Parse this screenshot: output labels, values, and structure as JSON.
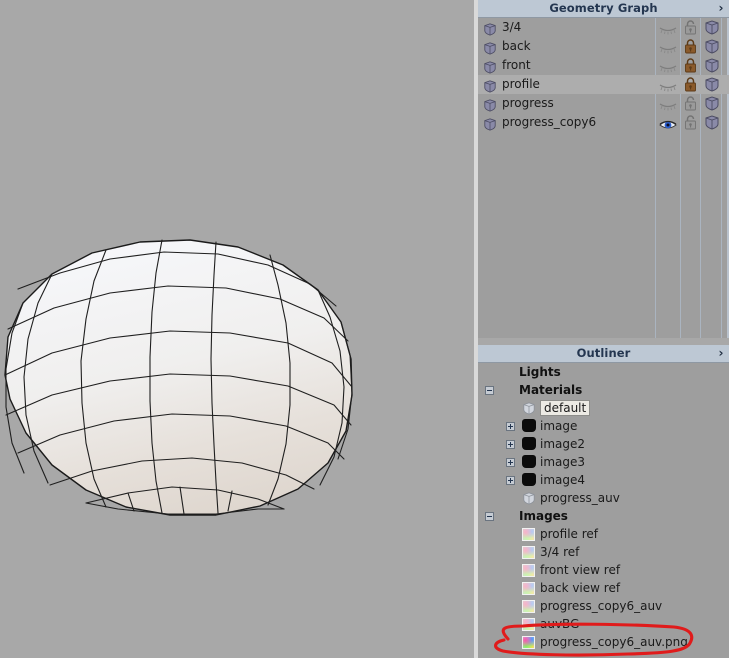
{
  "app": {
    "viewport": {
      "name": "3d-viewport",
      "background_color": "#a8a8a8",
      "model": "low-poly sphere wireframe",
      "mesh_color": "#f2f0ee",
      "wire_color": "#1a1a1a"
    }
  },
  "geometry_graph": {
    "title": "Geometry Graph",
    "chevron": "›",
    "columns": [
      "name",
      "visibility",
      "lock",
      "render"
    ],
    "rows": [
      {
        "label": "3/4",
        "visible": false,
        "locked": false,
        "selected": false
      },
      {
        "label": "back",
        "visible": false,
        "locked": true,
        "selected": false
      },
      {
        "label": "front",
        "visible": false,
        "locked": true,
        "selected": false
      },
      {
        "label": "profile",
        "visible": false,
        "locked": true,
        "selected": true
      },
      {
        "label": "progress",
        "visible": false,
        "locked": false,
        "selected": false
      },
      {
        "label": "progress_copy6",
        "visible": true,
        "locked": false,
        "selected": false
      }
    ]
  },
  "outliner": {
    "title": "Outliner",
    "chevron": "›",
    "groups": [
      {
        "label": "Lights",
        "expander": "none",
        "items": []
      },
      {
        "label": "Materials",
        "expander": "minus",
        "items": [
          {
            "label": "default",
            "icon": "cube-icon",
            "expander": "none",
            "highlight": true
          },
          {
            "label": "image",
            "icon": "black-material-icon",
            "expander": "plus",
            "highlight": false
          },
          {
            "label": "image2",
            "icon": "black-material-icon",
            "expander": "plus",
            "highlight": false
          },
          {
            "label": "image3",
            "icon": "black-material-icon",
            "expander": "plus",
            "highlight": false
          },
          {
            "label": "image4",
            "icon": "black-material-icon",
            "expander": "plus",
            "highlight": false
          },
          {
            "label": "progress_auv",
            "icon": "cube-icon",
            "expander": "none",
            "highlight": false
          }
        ]
      },
      {
        "label": "Images",
        "expander": "minus",
        "items": [
          {
            "label": "profile ref",
            "icon": "image-thumb-icon",
            "expander": "none",
            "highlight": false,
            "vivid": false
          },
          {
            "label": "3/4 ref",
            "icon": "image-thumb-icon",
            "expander": "none",
            "highlight": false,
            "vivid": false
          },
          {
            "label": "front view ref",
            "icon": "image-thumb-icon",
            "expander": "none",
            "highlight": false,
            "vivid": false
          },
          {
            "label": "back view ref",
            "icon": "image-thumb-icon",
            "expander": "none",
            "highlight": false,
            "vivid": false
          },
          {
            "label": "progress_copy6_auv",
            "icon": "image-thumb-icon",
            "expander": "none",
            "highlight": false,
            "vivid": false
          },
          {
            "label": "auvBG",
            "icon": "image-thumb-icon",
            "expander": "none",
            "highlight": false,
            "vivid": false
          },
          {
            "label": "progress_copy6_auv.png",
            "icon": "image-thumb-icon",
            "expander": "none",
            "highlight": false,
            "vivid": true,
            "annotated": true
          }
        ]
      }
    ]
  },
  "annotation": {
    "type": "hand-drawn-ellipse",
    "color": "#e01b1b",
    "target_label": "progress_copy6_auv.png"
  },
  "colors": {
    "viewport_bg": "#a8a8a8",
    "panel_bg": "#9e9e9e",
    "header_bg": "#bdc8d4",
    "header_text": "#243650",
    "selected_row": "#adadad",
    "lock_locked": "#8a5a2b",
    "lock_unlocked": "#9a9a9a",
    "eye_open": "#2a5fd0",
    "cube_icon": "#8a8aa8",
    "annotation_red": "#e01b1b"
  }
}
